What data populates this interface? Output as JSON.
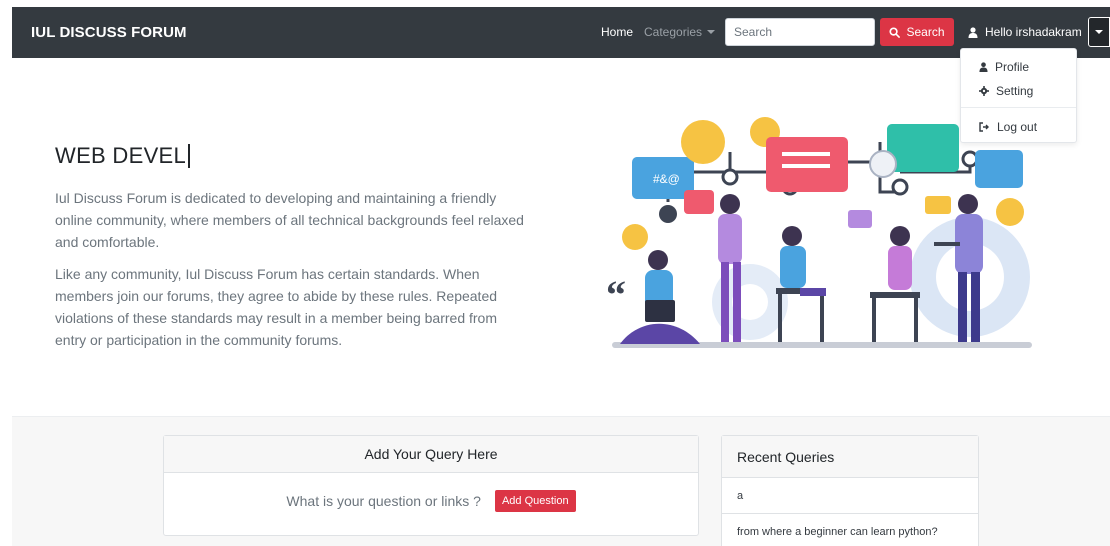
{
  "navbar": {
    "brand": "IUL DISCUSS FORUM",
    "home": "Home",
    "categories": "Categories",
    "search_placeholder": "Search",
    "search_button": "Search",
    "user_greeting": "Hello irshadakram"
  },
  "user_menu": {
    "items": [
      {
        "label": "Profile",
        "icon": "user-icon"
      },
      {
        "label": "Setting",
        "icon": "gear-icon"
      },
      {
        "label": "Log out",
        "icon": "sign-out-icon"
      }
    ]
  },
  "hero": {
    "title": "WEB DEVEL",
    "paragraph1": "Iul Discuss Forum is dedicated to developing and maintaining a friendly online community, where members of all technical backgrounds feel relaxed and comfortable.",
    "paragraph2": "Like any community, Iul Discuss Forum has certain standards. When members join our forums, they agree to abide by these rules. Repeated violations of these standards may result in a member being barred from entry or participation in the community forums.",
    "illustration_symbol": "#&@"
  },
  "query_card": {
    "title": "Add Your Query Here",
    "prompt": "What is your question or links ?",
    "button": "Add Question"
  },
  "recent_card": {
    "title": "Recent Queries",
    "items": [
      "a",
      "from where a beginner can learn python?"
    ]
  },
  "colors": {
    "navbar_bg": "#343a40",
    "accent_red": "#dc3545",
    "text_muted": "#6c757d"
  }
}
